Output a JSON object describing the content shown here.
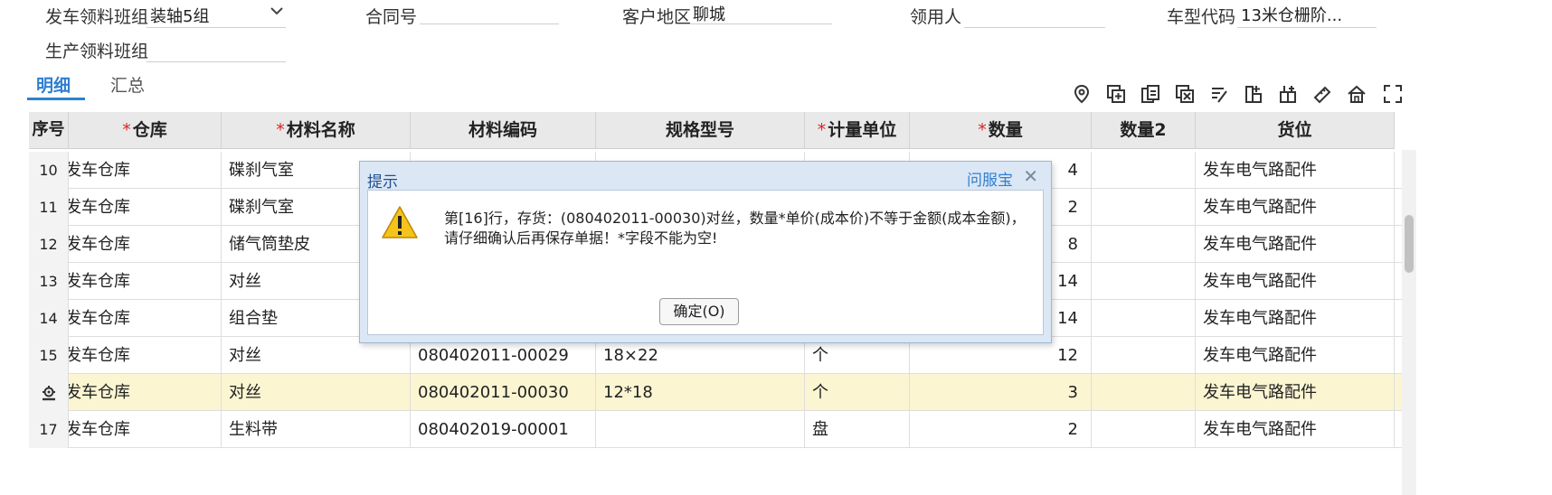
{
  "form": {
    "issue_group_label": "发车领料班组",
    "issue_group_value": "装轴5组",
    "contract_label": "合同号",
    "contract_value": "",
    "region_label": "客户地区",
    "region_value": "聊城",
    "receiver_label": "领用人",
    "receiver_value": "",
    "model_label": "车型代码",
    "model_value": "13米仓栅阶...",
    "prod_group_label": "生产领料班组",
    "prod_group_value": ""
  },
  "tabs": [
    {
      "label": "明细",
      "active": true
    },
    {
      "label": "汇总",
      "active": false
    }
  ],
  "toolbar_icons": [
    "location-icon",
    "add-row-icon",
    "copy-row-icon",
    "delete-row-icon",
    "batch-edit-icon",
    "insert-before-icon",
    "insert-after-icon",
    "tag-icon",
    "home-icon",
    "fullscreen-icon"
  ],
  "grid": {
    "columns": [
      {
        "label": "序号",
        "required": false
      },
      {
        "label": "仓库",
        "required": true
      },
      {
        "label": "材料名称",
        "required": true
      },
      {
        "label": "材料编码",
        "required": false
      },
      {
        "label": "规格型号",
        "required": false
      },
      {
        "label": "计量单位",
        "required": true
      },
      {
        "label": "数量",
        "required": true
      },
      {
        "label": "数量2",
        "required": false
      },
      {
        "label": "货位",
        "required": false
      }
    ],
    "rows": [
      {
        "seq": "10",
        "warehouse": "发车仓库",
        "name": "碟刹气室",
        "code": "",
        "spec": "",
        "unit": "",
        "qty": "4",
        "qty2": "",
        "loc": "发车电气路配件"
      },
      {
        "seq": "11",
        "warehouse": "发车仓库",
        "name": "碟刹气室",
        "code": "",
        "spec": "",
        "unit": "",
        "qty": "2",
        "qty2": "",
        "loc": "发车电气路配件"
      },
      {
        "seq": "12",
        "warehouse": "发车仓库",
        "name": "储气筒垫皮",
        "code": "",
        "spec": "",
        "unit": "",
        "qty": "8",
        "qty2": "",
        "loc": "发车电气路配件"
      },
      {
        "seq": "13",
        "warehouse": "发车仓库",
        "name": "对丝",
        "code": "",
        "spec": "",
        "unit": "",
        "qty": "14",
        "qty2": "",
        "loc": "发车电气路配件"
      },
      {
        "seq": "14",
        "warehouse": "发车仓库",
        "name": "组合垫",
        "code": "",
        "spec": "",
        "unit": "",
        "qty": "14",
        "qty2": "",
        "loc": "发车电气路配件"
      },
      {
        "seq": "15",
        "warehouse": "发车仓库",
        "name": "对丝",
        "code": "080402011-00029",
        "spec": "18×22",
        "unit": "个",
        "qty": "12",
        "qty2": "",
        "loc": "发车电气路配件"
      },
      {
        "seq": "",
        "warehouse": "发车仓库",
        "name": "对丝",
        "code": "080402011-00030",
        "spec": "12*18",
        "unit": "个",
        "qty": "3",
        "qty2": "",
        "loc": "发车电气路配件",
        "selected": true
      },
      {
        "seq": "17",
        "warehouse": "发车仓库",
        "name": "生料带",
        "code": "080402019-00001",
        "spec": "",
        "unit": "盘",
        "qty": "2",
        "qty2": "",
        "loc": "发车电气路配件"
      }
    ]
  },
  "dialog": {
    "title": "提示",
    "brand": "问服宝",
    "close": "✕",
    "message_line1": "第[16]行，存货：(080402011-00030)对丝，数量*单价(成本价)不等于金额(成本金额)，",
    "message_line2": "请仔细确认后再保存单据！*字段不能为空!",
    "ok_label": "确定(O)",
    "icon": "warning-icon"
  },
  "colors": {
    "accent": "#2f7fd1",
    "required": "#e02020",
    "header_bg": "#e9e9e9",
    "selected_row": "#fbf5d2",
    "dialog_frame": "#dbe7f5"
  }
}
